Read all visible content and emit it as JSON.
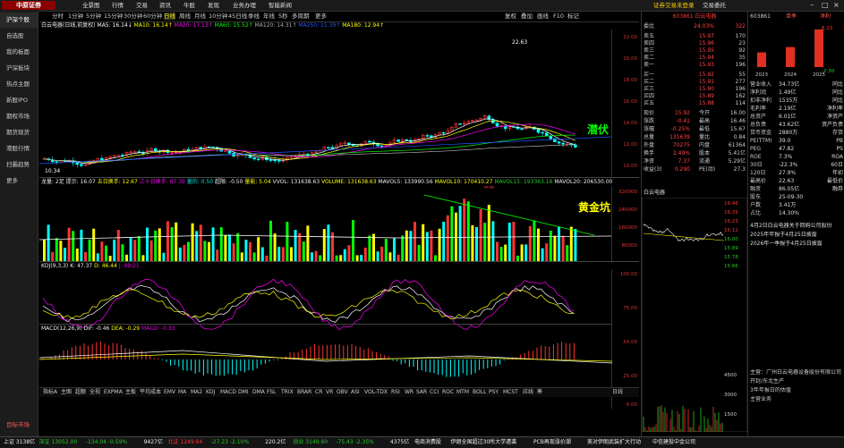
{
  "app": {
    "logo": "中原证券",
    "menu": [
      "全景图",
      "行情",
      "交易",
      "资讯",
      "牛股",
      "发现",
      "业务办理",
      "智能新闻"
    ],
    "top_right": [
      "证券交易未登录",
      "交易委托"
    ]
  },
  "sidebar": {
    "items": [
      "沪深个股",
      "自选股",
      "我的板面",
      "沪深板块",
      "热点主题",
      "新股IPO",
      "期权市场",
      "期货现货",
      "港股行情",
      "扫霸趋势",
      "更多"
    ],
    "bottom": "目标市场"
  },
  "periods": {
    "items": [
      "分时",
      "1分钟",
      "5分钟",
      "15分钟",
      "30分钟",
      "60分钟",
      "日线",
      "周线",
      "月线",
      "10分钟",
      "45日线",
      "季线",
      "年线",
      "5秒",
      "多周期",
      "更多"
    ],
    "active": "日线",
    "right": [
      "复权",
      "叠加",
      "画线",
      "F10",
      "标记",
      "-",
      "□"
    ]
  },
  "main_chart": {
    "title": "白云电器(日线,前复权)",
    "ma_legend": [
      {
        "label": "MA5: 16.14↓",
        "color": "#ffffff"
      },
      {
        "label": "MA10: 16.14↑",
        "color": "#ffff00"
      },
      {
        "label": "MA20: 17.13↑",
        "color": "#ff00ff"
      },
      {
        "label": "MA60: 15.52↑",
        "color": "#00ff00"
      },
      {
        "label": "MA120: 14.31↑",
        "color": "#aaaaaa"
      },
      {
        "label": "MA250: 11.39↑",
        "color": "#2255ff"
      },
      {
        "label": "MA180: 12.94↑",
        "color": "#ffff00"
      }
    ],
    "high_label": "22.63",
    "low_label": "10.34",
    "tag": "潜伏",
    "yaxis": [
      "22.00",
      "20.00",
      "18.00",
      "16.00",
      "14.00",
      "12.00",
      "10.00"
    ]
  },
  "volume_chart": {
    "legend": [
      "龙量: 2足",
      "提示: 16.07",
      "五日换手: 12.67",
      "三十日换手: 87.39",
      "量的: 0.50",
      "超限: -0.50",
      "量能: 5.04",
      "VVOL: 131638.63",
      "VOLUME: 131638.63",
      "MAVOL5: 133990.56",
      "MAVOL10: 170410.27",
      "MAVOL15: 193363.16",
      "MAVOL20: 206530.00"
    ],
    "tag": "黄金坑",
    "marker": "涨幅",
    "yaxis": [
      "320000",
      "240000",
      "160000",
      "80000"
    ]
  },
  "kdj_chart": {
    "legend": [
      "KDJ(9,3,3)",
      "K: 47.37",
      "D: 46.44",
      "J: 49.21"
    ],
    "yaxis": [
      "100.00",
      "75.00",
      "50.00",
      "25.00",
      "0.00"
    ]
  },
  "macd_chart": {
    "legend": [
      "MACD(12,26,9)",
      "DIF: -0.46",
      "DEA: -0.29",
      "MACD: -0.33"
    ],
    "yaxis": [
      "1.00",
      "0.50",
      "0.00",
      "-0.50"
    ]
  },
  "indicators": {
    "items": [
      "指标A",
      "主图",
      "超额",
      "全视",
      "EXPMA",
      "主板",
      "平均成本",
      "EMV",
      "MA",
      "MA2",
      "KDJ",
      "MACD",
      "DMI",
      "DMA",
      "FSL",
      "TRIX",
      "BRAR",
      "CR",
      "VR",
      "OBV",
      "ASI",
      "VOL-TDX",
      "RSI",
      "WR",
      "SAR",
      "CCI",
      "ROC",
      "MTM",
      "BOLL",
      "PSY",
      "MCST",
      "应线",
      "筹",
      "日线"
    ]
  },
  "quote": {
    "code": "603861",
    "name": "白云电器",
    "wei_bi": "24.03%",
    "wei_cha": "322",
    "sells": [
      {
        "label": "卖五",
        "price": "15.97",
        "vol": "170"
      },
      {
        "label": "卖四",
        "price": "15.96",
        "vol": "23"
      },
      {
        "label": "卖三",
        "price": "15.95",
        "vol": "92"
      },
      {
        "label": "卖二",
        "price": "15.94",
        "vol": "35"
      },
      {
        "label": "卖一",
        "price": "15.93",
        "vol": "196"
      }
    ],
    "buys": [
      {
        "label": "买一",
        "price": "15.92",
        "vol": "55"
      },
      {
        "label": "买二",
        "price": "15.91",
        "vol": "277"
      },
      {
        "label": "买三",
        "price": "15.90",
        "vol": "196"
      },
      {
        "label": "买四",
        "price": "15.89",
        "vol": "162"
      },
      {
        "label": "买五",
        "price": "15.88",
        "vol": "114"
      }
    ],
    "stats": [
      {
        "l": "现价",
        "v": "15.92",
        "l2": "今开",
        "v2": "16.00"
      },
      {
        "l": "涨跌",
        "v": "-0.41",
        "l2": "最高",
        "v2": "16.46"
      },
      {
        "l": "涨幅",
        "v": "-0.25%",
        "l2": "最低",
        "v2": "15.67"
      },
      {
        "l": "总量",
        "v": "131639",
        "l2": "量比",
        "v2": "0.84"
      },
      {
        "l": "外盘",
        "v": "70275",
        "l2": "内盘",
        "v2": "61364"
      },
      {
        "l": "换手",
        "v": "2.49%",
        "l2": "股本",
        "v2": "5.41亿"
      },
      {
        "l": "净资",
        "v": "7.37",
        "l2": "流通",
        "v2": "5.29亿"
      },
      {
        "l": "收益(3)",
        "v": "0.290",
        "l2": "PE(动)",
        "v2": "27.3"
      }
    ],
    "mini_title": "白云电器",
    "mini_yaxis": [
      "16.46",
      "16.35",
      "16.23",
      "16.12",
      "16.00",
      "15.89",
      "15.78",
      "15.66"
    ],
    "mini_vol": [
      "4500",
      "3000",
      "1500"
    ]
  },
  "f10": {
    "code": "603861",
    "tabs": [
      "单季",
      "净利"
    ],
    "chart_values": [
      {
        "year": "2023",
        "v": 3.21
      },
      {
        "year": "2024",
        "v": 4.38
      },
      {
        "year": "2025",
        "v": 8.23
      }
    ],
    "chart_labels": [
      "8.23",
      "-2.30"
    ],
    "rows": [
      {
        "l": "营业收入",
        "r": "34.73亿",
        "m": "同比"
      },
      {
        "l": "净利润",
        "r": "1.49亿",
        "m": "同比"
      },
      {
        "l": "扣非净利",
        "r": "1535万",
        "m": "同比"
      },
      {
        "l": "毛利率",
        "r": "2.19亿",
        "m": "净利率"
      },
      {
        "l": "总资产",
        "r": "6.01亿",
        "m": "净资产"
      },
      {
        "l": "总负债",
        "r": "43.62亿",
        "m": "资产负债"
      },
      {
        "l": "货币资金",
        "r": "2880万",
        "m": "存货"
      },
      {
        "l": "PE(TTM)",
        "r": "39.0",
        "m": "PB"
      },
      {
        "l": "PEG",
        "r": "47.82",
        "m": "PS"
      },
      {
        "l": "ROE",
        "r": "7.3%",
        "m": "ROA"
      },
      {
        "l": "30日",
        "r": "-22.3%",
        "m": "60日"
      },
      {
        "l": "120日",
        "r": "27.9%",
        "m": "年初"
      },
      {
        "l": "最高价",
        "r": "22.63",
        "m": "最低价"
      },
      {
        "l": "融资",
        "r": "86.05亿",
        "m": "融券"
      },
      {
        "l": "股东",
        "r": "25-09-30",
        "m": ""
      },
      {
        "l": "户数",
        "r": "3.41万",
        "m": ""
      },
      {
        "l": "占比",
        "r": "14.30%",
        "m": ""
      }
    ],
    "news": [
      "4月2日白云电器关于回购公司股份",
      "2025年年报于4月25日披露",
      "2026年一季报于4月25日披露"
    ],
    "bottom": [
      "主营：广州白云电器设备股份有限公司",
      "开封/东北生产",
      "3年年报日的估值",
      "主营业务"
    ]
  },
  "status": {
    "items": [
      {
        "t": "上证",
        "v": "3138亿",
        "c": "white"
      },
      {
        "t": "深证",
        "v": "13052.00",
        "c": "green"
      },
      {
        "t": "-134.04",
        "v": "-0.59%",
        "c": "green"
      },
      {
        "t": "9427亿",
        "v": "",
        "c": "white"
      },
      {
        "t": "北证",
        "v": "1249.64",
        "c": "red"
      },
      {
        "t": "-27.23",
        "v": "-2.10%",
        "c": "green"
      },
      {
        "t": "220.2亿",
        "v": "",
        "c": "white"
      },
      {
        "t": "创业",
        "v": "3149.60",
        "c": "green"
      },
      {
        "t": "-75.43",
        "v": "-2.35%",
        "c": "green"
      },
      {
        "t": "4375亿",
        "v": "",
        "c": "white"
      }
    ],
    "ticker": [
      "电商消费股",
      "伊朗全国超过30所大学遭袭",
      "PCB再现涨价潮",
      "美对伊朗武装扩大行动",
      "中信建投中金公司"
    ]
  }
}
